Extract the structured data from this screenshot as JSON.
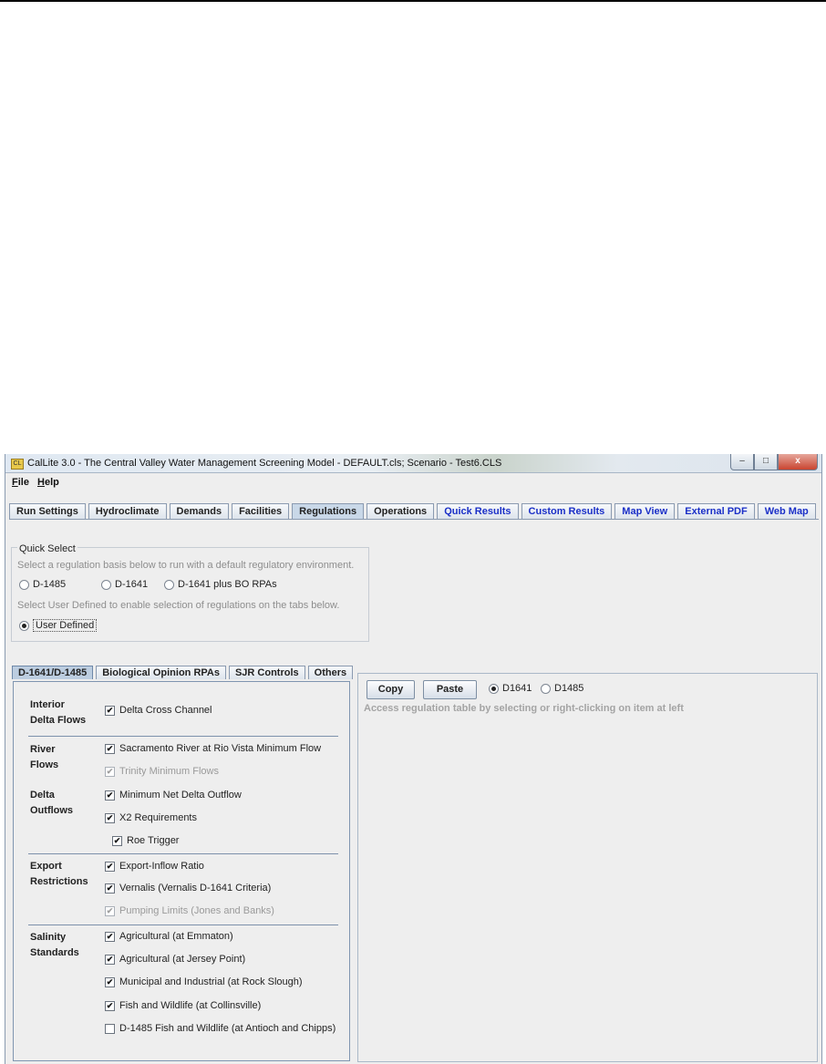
{
  "window": {
    "title": "CalLite 3.0 -  The Central Valley Water Management Screening Model - DEFAULT.cls;  Scenario - Test6.CLS",
    "app_icon_text": "CL",
    "controls": {
      "minimize": "–",
      "maximize": "□",
      "close": "x"
    }
  },
  "menu": {
    "file": {
      "ul": "F",
      "rest": "ile"
    },
    "help": {
      "ul": "H",
      "rest": "elp"
    }
  },
  "main_tabs": [
    {
      "label": "Run Settings",
      "link": false
    },
    {
      "label": "Hydroclimate",
      "link": false
    },
    {
      "label": "Demands",
      "link": false
    },
    {
      "label": "Facilities",
      "link": false
    },
    {
      "label": "Regulations",
      "link": false,
      "active": true
    },
    {
      "label": "Operations",
      "link": false
    },
    {
      "label": "Quick Results",
      "link": true
    },
    {
      "label": "Custom Results",
      "link": true
    },
    {
      "label": "Map View",
      "link": true
    },
    {
      "label": "External PDF",
      "link": true
    },
    {
      "label": "Web Map",
      "link": true
    }
  ],
  "quick_select": {
    "title": "Quick Select",
    "line1": "Select a regulation basis below to run with a default regulatory environment.",
    "options": [
      "D-1485",
      "D-1641",
      "D-1641 plus BO RPAs"
    ],
    "line2": "Select User Defined to enable selection of regulations on the tabs below.",
    "user_defined": "User Defined",
    "selected": "User Defined"
  },
  "sub_tabs": [
    "D-1641/D-1485",
    "Biological Opinion RPAs",
    "SJR Controls",
    "Others"
  ],
  "active_sub_tab": "D-1641/D-1485",
  "groups": {
    "interior": {
      "line1": "Interior",
      "line2": "Delta Flows"
    },
    "river": {
      "line1": "River",
      "line2": "Flows"
    },
    "delta": {
      "line1": "Delta",
      "line2": "Outflows"
    },
    "export": {
      "line1": "Export",
      "line2": "Restrictions"
    },
    "salinity": {
      "line1": "Salinity",
      "line2": "Standards"
    }
  },
  "checkbox_mark": "✔",
  "regulations": {
    "delta_cross_channel": {
      "label": "Delta Cross Channel",
      "checked": true
    },
    "sacramento_rio_vista": {
      "label": "Sacramento River at Rio Vista Minimum Flow",
      "checked": true
    },
    "trinity_minimum": {
      "label": "Trinity Minimum Flows",
      "checked": true,
      "disabled": true
    },
    "min_net_delta_outflow": {
      "label": "Minimum Net Delta Outflow",
      "checked": true
    },
    "x2": {
      "label": "X2 Requirements",
      "checked": true
    },
    "roe_trigger": {
      "label": "Roe Trigger",
      "checked": true
    },
    "export_inflow_ratio": {
      "label": "Export-Inflow Ratio",
      "checked": true
    },
    "vernalis": {
      "label": "Vernalis (Vernalis D-1641 Criteria)",
      "checked": true
    },
    "pumping_limits": {
      "label": "Pumping Limits (Jones and Banks)",
      "checked": true,
      "disabled": true
    },
    "ag_emmaton": {
      "label": "Agricultural (at Emmaton)",
      "checked": true
    },
    "ag_jersey_point": {
      "label": "Agricultural (at Jersey Point)",
      "checked": true
    },
    "mi_rock_slough": {
      "label": "Municipal and Industrial (at Rock Slough)",
      "checked": true
    },
    "fw_collinsville": {
      "label": "Fish and Wildlife (at Collinsville)",
      "checked": true
    },
    "d1485_fw": {
      "label": "D-1485 Fish and Wildlife (at Antioch and Chipps)",
      "checked": false
    }
  },
  "right_panel": {
    "copy": "Copy",
    "paste": "Paste",
    "table_options": [
      "D1641",
      "D1485"
    ],
    "table_selected": "D1641",
    "hint": "Access regulation table by selecting or right-clicking on item at left"
  }
}
